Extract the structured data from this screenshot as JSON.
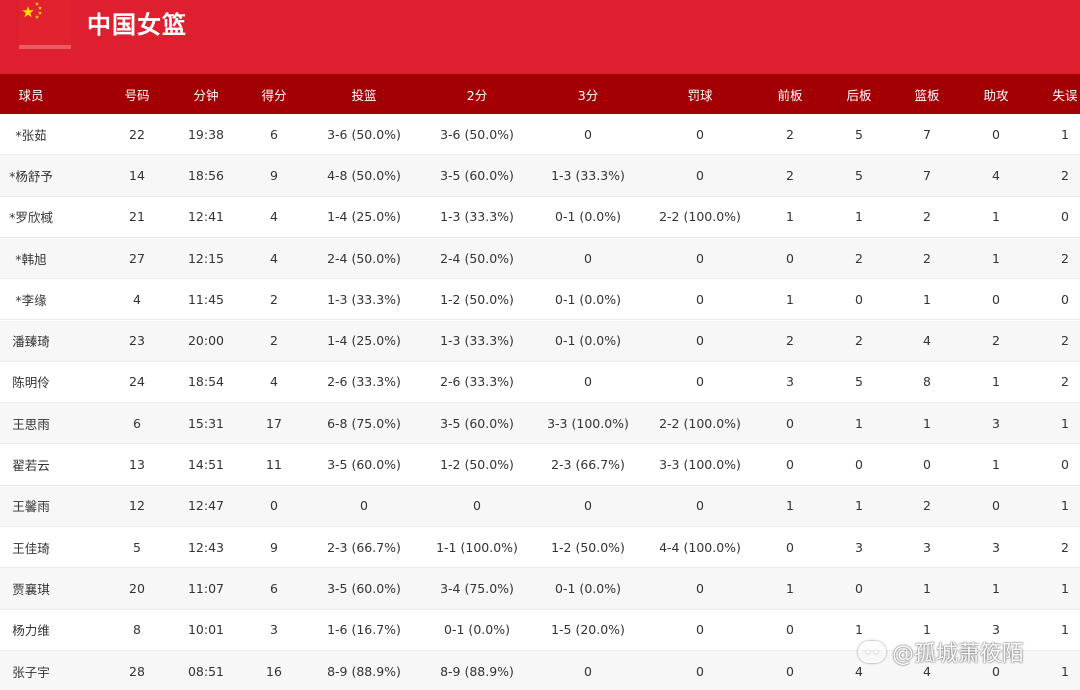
{
  "team": {
    "name": "中国女篮",
    "flag_icon": "china-flag-icon"
  },
  "columns": [
    "球员",
    "号码",
    "分钟",
    "得分",
    "投篮",
    "2分",
    "3分",
    "罚球",
    "前板",
    "后板",
    "篮板",
    "助攻",
    "失误"
  ],
  "players": [
    [
      "*张茹",
      "22",
      "19:38",
      "6",
      "3-6 (50.0%)",
      "3-6 (50.0%)",
      "0",
      "0",
      "2",
      "5",
      "7",
      "0",
      "1"
    ],
    [
      "*杨舒予",
      "14",
      "18:56",
      "9",
      "4-8 (50.0%)",
      "3-5 (60.0%)",
      "1-3 (33.3%)",
      "0",
      "2",
      "5",
      "7",
      "4",
      "2"
    ],
    [
      "*罗欣棫",
      "21",
      "12:41",
      "4",
      "1-4 (25.0%)",
      "1-3 (33.3%)",
      "0-1 (0.0%)",
      "2-2 (100.0%)",
      "1",
      "1",
      "2",
      "1",
      "0"
    ],
    [
      "*韩旭",
      "27",
      "12:15",
      "4",
      "2-4 (50.0%)",
      "2-4 (50.0%)",
      "0",
      "0",
      "0",
      "2",
      "2",
      "1",
      "2"
    ],
    [
      "*李缘",
      "4",
      "11:45",
      "2",
      "1-3 (33.3%)",
      "1-2 (50.0%)",
      "0-1 (0.0%)",
      "0",
      "1",
      "0",
      "1",
      "0",
      "0"
    ],
    [
      "潘臻琦",
      "23",
      "20:00",
      "2",
      "1-4 (25.0%)",
      "1-3 (33.3%)",
      "0-1 (0.0%)",
      "0",
      "2",
      "2",
      "4",
      "2",
      "2"
    ],
    [
      "陈明伶",
      "24",
      "18:54",
      "4",
      "2-6 (33.3%)",
      "2-6 (33.3%)",
      "0",
      "0",
      "3",
      "5",
      "8",
      "1",
      "2"
    ],
    [
      "王思雨",
      "6",
      "15:31",
      "17",
      "6-8 (75.0%)",
      "3-5 (60.0%)",
      "3-3 (100.0%)",
      "2-2 (100.0%)",
      "0",
      "1",
      "1",
      "3",
      "1"
    ],
    [
      "翟若云",
      "13",
      "14:51",
      "11",
      "3-5 (60.0%)",
      "1-2 (50.0%)",
      "2-3 (66.7%)",
      "3-3 (100.0%)",
      "0",
      "0",
      "0",
      "1",
      "0"
    ],
    [
      "王馨雨",
      "12",
      "12:47",
      "0",
      "0",
      "0",
      "0",
      "0",
      "1",
      "1",
      "2",
      "0",
      "1"
    ],
    [
      "王佳琦",
      "5",
      "12:43",
      "9",
      "2-3 (66.7%)",
      "1-1 (100.0%)",
      "1-2 (50.0%)",
      "4-4 (100.0%)",
      "0",
      "3",
      "3",
      "3",
      "2"
    ],
    [
      "贾襄琪",
      "20",
      "11:07",
      "6",
      "3-5 (60.0%)",
      "3-4 (75.0%)",
      "0-1 (0.0%)",
      "0",
      "1",
      "0",
      "1",
      "1",
      "1"
    ],
    [
      "杨力维",
      "8",
      "10:01",
      "3",
      "1-6 (16.7%)",
      "0-1 (0.0%)",
      "1-5 (20.0%)",
      "0",
      "0",
      "1",
      "1",
      "3",
      "1"
    ],
    [
      "张子宇",
      "28",
      "08:51",
      "16",
      "8-9 (88.9%)",
      "8-9 (88.9%)",
      "0",
      "0",
      "0",
      "4",
      "4",
      "0",
      "1"
    ]
  ],
  "watermark": {
    "text": "@孤城萧筱陌",
    "icon": "chat-bubble-icon"
  },
  "colors": {
    "header_bg": "#dd1f30",
    "table_head_bg": "#a30006",
    "row_alt_bg": "#f7f7f7",
    "text": "#333333"
  }
}
